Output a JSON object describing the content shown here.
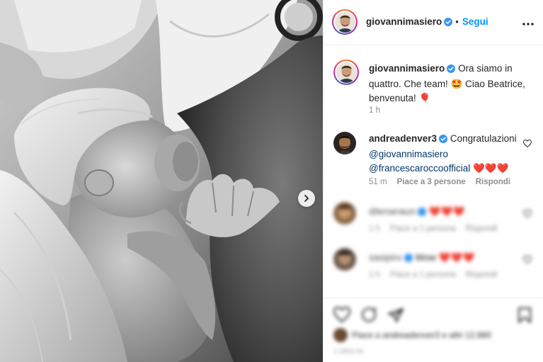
{
  "header": {
    "username": "giovannimasiero",
    "separator": "•",
    "follow_label": "Segui",
    "more_icon": "more-horizontal-icon"
  },
  "caption": {
    "username": "giovannimasiero",
    "text": "Ora siamo in quattro. Che team! 🤩 Ciao Beatrice, benvenuta! 🎈",
    "time": "1 h"
  },
  "comments": [
    {
      "username": "andreadenver3",
      "text_prefix": "Congratulazioni",
      "mention_1": "@giovannimasiero",
      "mention_2": "@francescaroccoofficial",
      "hearts": "❤️❤️❤️",
      "time": "51 m",
      "likes": "Piace a 3 persone",
      "reply": "Rispondi"
    },
    {
      "username": "dilenanaun",
      "hearts": "❤️❤️❤️",
      "time": "1 h",
      "likes": "Piace a 1 persona",
      "reply": "Rispondi"
    },
    {
      "username": "sasipiro",
      "text": "Wow",
      "hearts": "❤️❤️❤️",
      "time": "1 h",
      "likes": "Piace a 1 persona",
      "reply": "Rispondi"
    }
  ],
  "actions": {
    "liked_by": "Piace a andreadenver3 e altri 12.880",
    "date": "1 ORA FA"
  },
  "colors": {
    "link": "#0095f6",
    "mention": "#00376b",
    "meta": "#8e8e8e",
    "verified": "#3897f0",
    "heart": "#ed4956"
  }
}
